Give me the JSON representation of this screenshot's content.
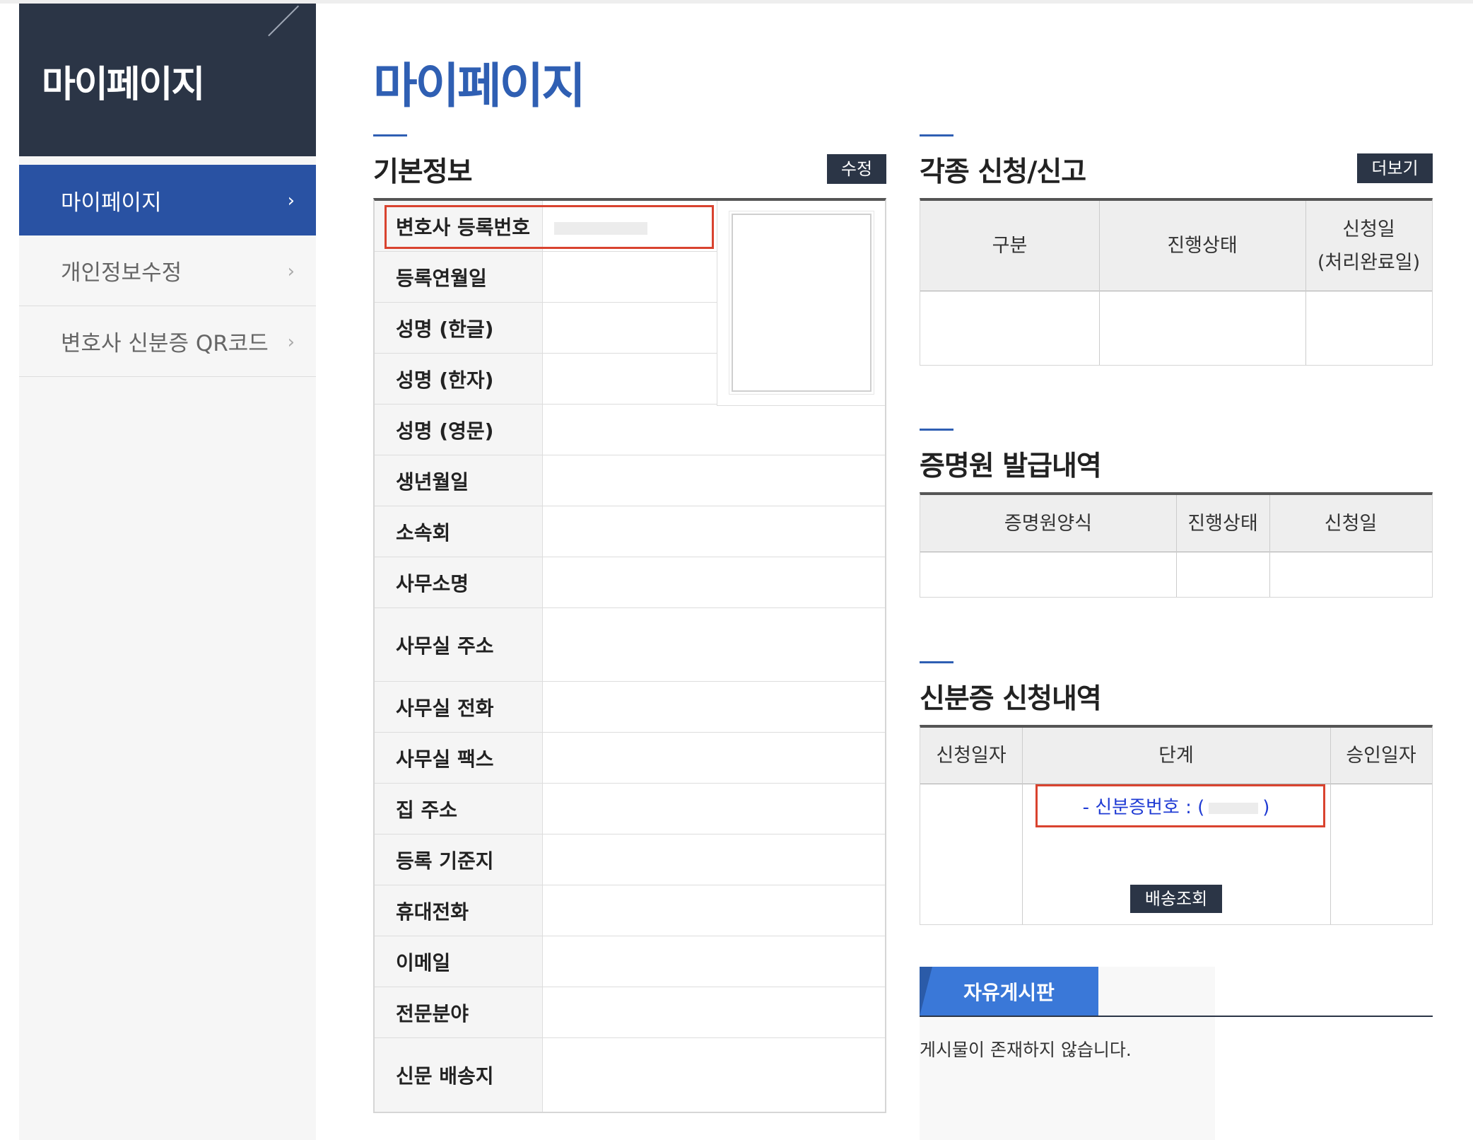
{
  "sidebar": {
    "title": "마이페이지",
    "items": [
      {
        "label": "마이페이지",
        "active": true
      },
      {
        "label": "개인정보수정",
        "active": false
      },
      {
        "label": "변호사 신분증 QR코드",
        "active": false
      }
    ]
  },
  "page_title": "마이페이지",
  "basic_info": {
    "title": "기본정보",
    "edit_label": "수정",
    "rows": [
      {
        "label": "변호사 등록번호"
      },
      {
        "label": "등록연월일"
      },
      {
        "label": "성명 (한글)"
      },
      {
        "label": "성명 (한자)"
      },
      {
        "label": "성명 (영문)"
      },
      {
        "label": "생년월일"
      },
      {
        "label": "소속회"
      },
      {
        "label": "사무소명"
      },
      {
        "label": "사무실 주소"
      },
      {
        "label": "사무실 전화"
      },
      {
        "label": "사무실 팩스"
      },
      {
        "label": "집 주소"
      },
      {
        "label": "등록 기준지"
      },
      {
        "label": "휴대전화"
      },
      {
        "label": "이메일"
      },
      {
        "label": "전문분야"
      },
      {
        "label": "신문 배송지"
      }
    ]
  },
  "applications": {
    "title": "각종 신청/신고",
    "more_label": "더보기",
    "headers": [
      "구분",
      "진행상태",
      "신청일\n(처리완료일)"
    ]
  },
  "certificates": {
    "title": "증명원 발급내역",
    "headers": [
      "증명원양식",
      "진행상태",
      "신청일"
    ]
  },
  "id_card": {
    "title": "신분증 신청내역",
    "headers": [
      "신청일자",
      "단계",
      "승인일자"
    ],
    "card_number_prefix": "- 신분증번호 : (",
    "card_number_suffix": ")",
    "delivery_label": "배송조회"
  },
  "board": {
    "tab_label": "자유게시판",
    "empty_message": "게시물이 존재하지 않습니다."
  },
  "colors": {
    "brand_blue": "#2f5fb3",
    "sidebar_dark": "#2b3546",
    "active_blue": "#2952a3",
    "highlight_red": "#d9432f",
    "link_blue": "#1f3bd4"
  }
}
